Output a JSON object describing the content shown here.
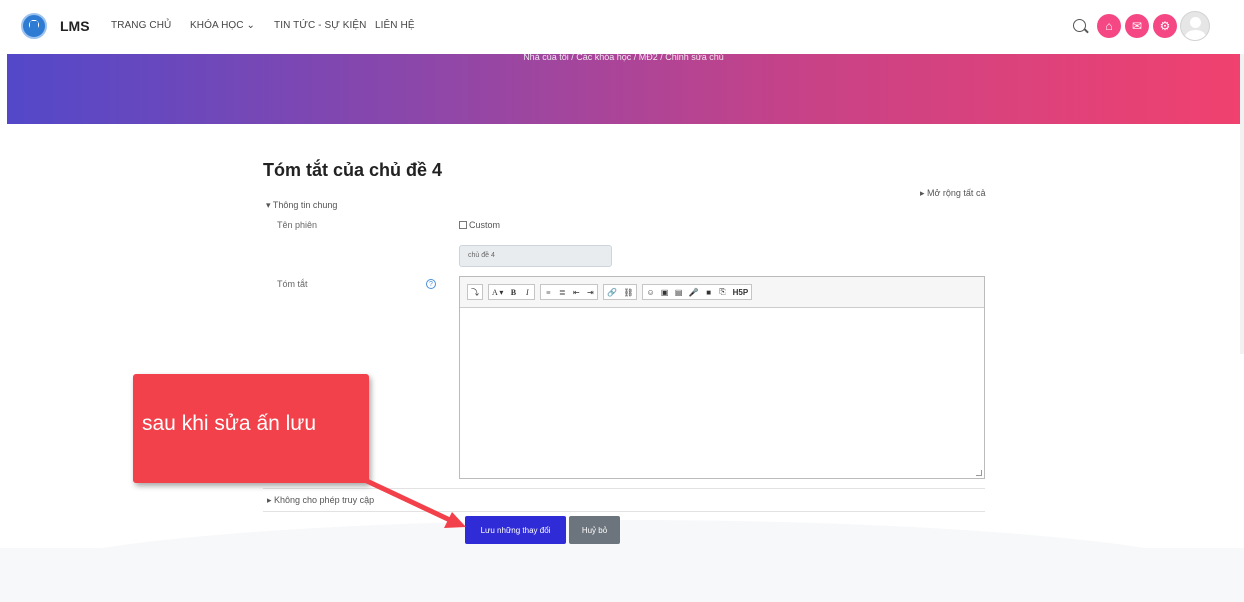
{
  "navbar": {
    "brand": "LMS",
    "items": [
      {
        "label": "TRANG CHỦ"
      },
      {
        "label": "KHÓA HỌC ⌄"
      },
      {
        "label": "TIN TỨC - SỰ KIỆN"
      },
      {
        "label": "LIÊN HỆ"
      }
    ]
  },
  "banner": {
    "breadcrumb": "Nhà của tôi / Các khóa học / MĐ2 / Chỉnh sửa chủ"
  },
  "form": {
    "title": "Tóm tắt của chủ đề 4",
    "expand_all": "▸ Mở rộng tất cả",
    "general_section": "▾  Thông tin chung",
    "name_label": "Tên phiên",
    "custom_label": "Custom",
    "name_value": "chủ đề 4",
    "summary_label": "Tóm tắt",
    "restrict_section": "▸  Không cho phép truy cập",
    "save_label": "Lưu những thay đổi",
    "cancel_label": "Huỷ bỏ"
  },
  "editor": {
    "toolbar_groups": [
      [
        "⤵"
      ],
      [
        "A ▾",
        "B",
        "I"
      ],
      [
        "≡",
        "≣",
        "⇤",
        "⇥"
      ],
      [
        "🔗",
        "⛓"
      ],
      [
        "☺",
        "▣",
        "▤",
        "🎤",
        "■",
        "⎘",
        "H5P"
      ]
    ]
  },
  "annotation": {
    "text": "sau khi sửa ấn lưu"
  },
  "colors": {
    "accent": "#f44783",
    "save_button": "#2f2bd6",
    "callout": "#f2414a"
  }
}
